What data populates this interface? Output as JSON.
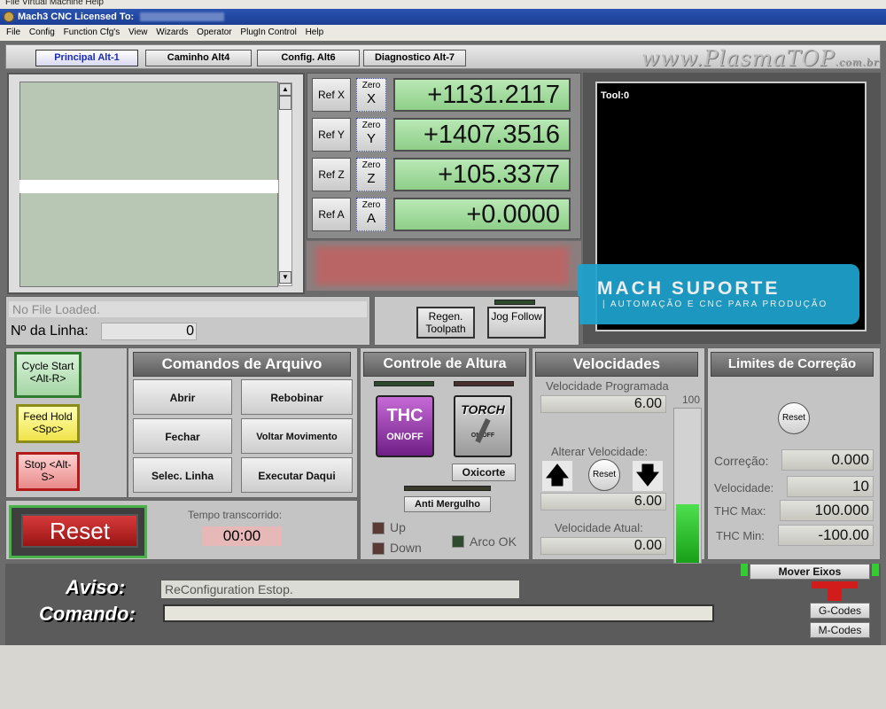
{
  "window": {
    "top_strip": "File  Virtual Machine  Help",
    "title_prefix": "Mach3 CNC  Licensed To:"
  },
  "menu": [
    "File",
    "Config",
    "Function Cfg's",
    "View",
    "Wizards",
    "Operator",
    "PlugIn Control",
    "Help"
  ],
  "tabs": [
    "Principal Alt-1",
    "Caminho Alt4",
    "Config. Alt6",
    "Diagnostico Alt-7"
  ],
  "brand": {
    "main": "www.PlasmaTOP",
    "suffix": ".com.br"
  },
  "axes": [
    {
      "ref": "Ref X",
      "zero_top": "Zero",
      "zero_axis": "X",
      "value": "+1131.2117"
    },
    {
      "ref": "Ref Y",
      "zero_top": "Zero",
      "zero_axis": "Y",
      "value": "+1407.3516"
    },
    {
      "ref": "Ref Z",
      "zero_top": "Zero",
      "zero_axis": "Z",
      "value": "+105.3377"
    },
    {
      "ref": "Ref A",
      "zero_top": "Zero",
      "zero_axis": "A",
      "value": "+0.0000"
    }
  ],
  "toolpath": {
    "tool_label": "Tool:0"
  },
  "suporte": {
    "title": "MACH SUPORTE",
    "subtitle": "| AUTOMAÇÃO E CNC PARA PRODUÇÃO"
  },
  "file": {
    "status": "No File Loaded.",
    "line_label": "Nº da Linha:",
    "line_value": "0"
  },
  "toolpath_buttons": {
    "regen": "Regen. Toolpath",
    "jog": "Jog Follow"
  },
  "cycle": {
    "start": "Cycle Start <Alt-R>",
    "hold": "Feed Hold <Spc>",
    "stop": "Stop <Alt-S>"
  },
  "reset": {
    "label": "Reset",
    "elapsed_label": "Tempo transcorrido:",
    "elapsed_value": "00:00"
  },
  "arquivo": {
    "title": "Comandos de Arquivo",
    "buttons": [
      "Abrir",
      "Rebobinar",
      "Fechar",
      "Voltar Movimento",
      "Selec. Linha",
      "Executar Daqui"
    ]
  },
  "altura": {
    "title": "Controle de Altura",
    "thc_label": "THC",
    "thc_sub": "ON/OFF",
    "torch_label": "TORCH",
    "torch_sub": "ON/OFF",
    "oxicorte": "Oxicorte",
    "anti": "Anti Mergulho",
    "up": "Up",
    "down": "Down",
    "arco": "Arco OK"
  },
  "velocidades": {
    "title": "Velocidades",
    "prog_label": "Velocidade Programada",
    "prog_value": "6.00",
    "max_label": "100",
    "alterar_label": "Alterar Velocidade:",
    "reset": "Reset",
    "override_value": "6.00",
    "atual_label": "Velocidade Atual:",
    "atual_value": "0.00",
    "fill_fraction": 0.06
  },
  "limites": {
    "title": "Limites de Correção",
    "reset": "Reset",
    "rows": [
      {
        "label": "Correção:",
        "value": "0.000"
      },
      {
        "label": "Velocidade:",
        "value": "10"
      },
      {
        "label": "THC Max:",
        "value": "100.000"
      },
      {
        "label": "THC Min:",
        "value": "-100.00"
      }
    ],
    "mover": "Mover Eixos"
  },
  "status": {
    "aviso_label": "Aviso:",
    "aviso_text": "ReConfiguration Estop.",
    "comando_label": "Comando:",
    "comando_value": "",
    "gcodes": "G-Codes",
    "mcodes": "M-Codes"
  },
  "colors": {
    "dro_green": "#9edb99",
    "title_blue": "#1c3e94",
    "reset_red": "#b51d1d",
    "suporte_blue": "#1fa3cf"
  }
}
